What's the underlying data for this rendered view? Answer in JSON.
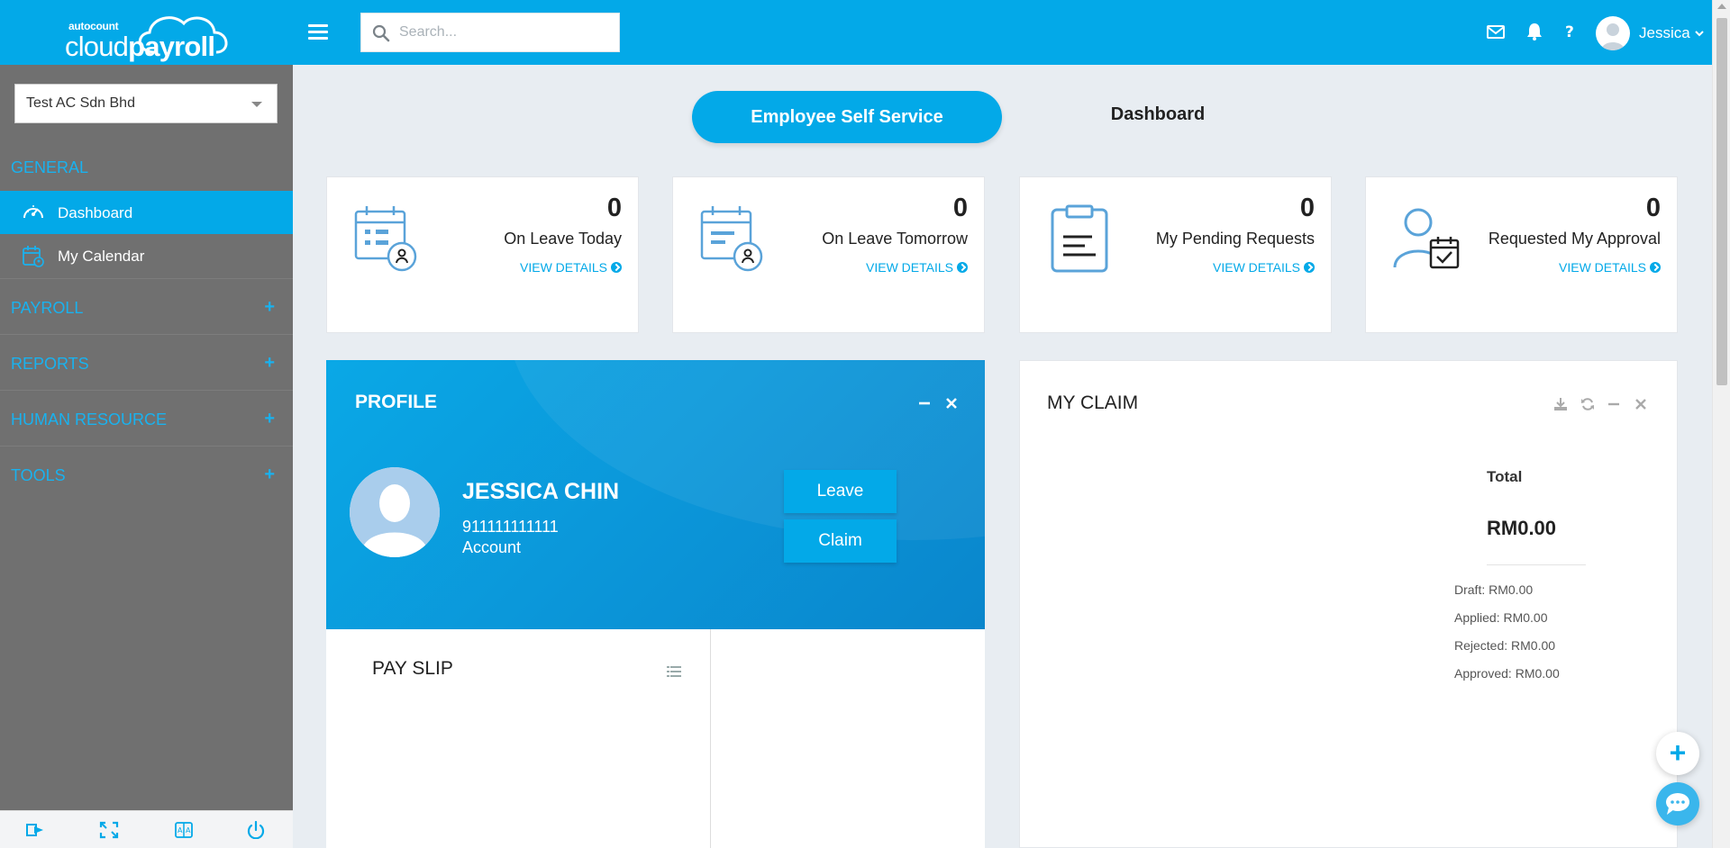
{
  "header": {
    "logo_small": "autocount",
    "logo_brand_light": "cloud",
    "logo_brand_bold": "payroll",
    "search_placeholder": "Search...",
    "user_name": "Jessica"
  },
  "sidebar": {
    "company": "Test AC Sdn Bhd",
    "sections": {
      "general": "GENERAL",
      "payroll": "PAYROLL",
      "reports": "REPORTS",
      "human_resource": "HUMAN RESOURCE",
      "tools": "TOOLS"
    },
    "items": [
      {
        "label": "Dashboard",
        "icon": "gauge-icon",
        "active": true
      },
      {
        "label": "My Calendar",
        "icon": "calendar-user-icon",
        "active": false
      }
    ],
    "footer_icons": [
      "sign-out-icon",
      "fullscreen-icon",
      "translate-icon",
      "power-icon"
    ]
  },
  "main": {
    "ess_button": "Employee Self Service",
    "dashboard_tab": "Dashboard",
    "stats": [
      {
        "count": "0",
        "title": "On Leave Today",
        "link": "VIEW DETAILS",
        "icon": "calendar-person-icon"
      },
      {
        "count": "0",
        "title": "On Leave Tomorrow",
        "link": "VIEW DETAILS",
        "icon": "calendar-person-icon"
      },
      {
        "count": "0",
        "title": "My Pending Requests",
        "link": "VIEW DETAILS",
        "icon": "clipboard-icon"
      },
      {
        "count": "0",
        "title": "Requested My Approval",
        "link": "VIEW DETAILS",
        "icon": "user-check-icon"
      }
    ],
    "profile": {
      "title": "PROFILE",
      "name": "JESSICA CHIN",
      "id": "911111111111",
      "department": "Account",
      "leave_button": "Leave",
      "claim_button": "Claim"
    },
    "payslip": {
      "title": "PAY SLIP"
    },
    "claim": {
      "title": "MY CLAIM",
      "total_label": "Total",
      "total_value": "RM0.00",
      "draft": "Draft: RM0.00",
      "applied": "Applied: RM0.00",
      "rejected": "Rejected: RM0.00",
      "approved": "Approved: RM0.00"
    }
  },
  "colors": {
    "primary": "#03a9e8",
    "sidebar": "#707070",
    "background": "#e8edf2"
  }
}
